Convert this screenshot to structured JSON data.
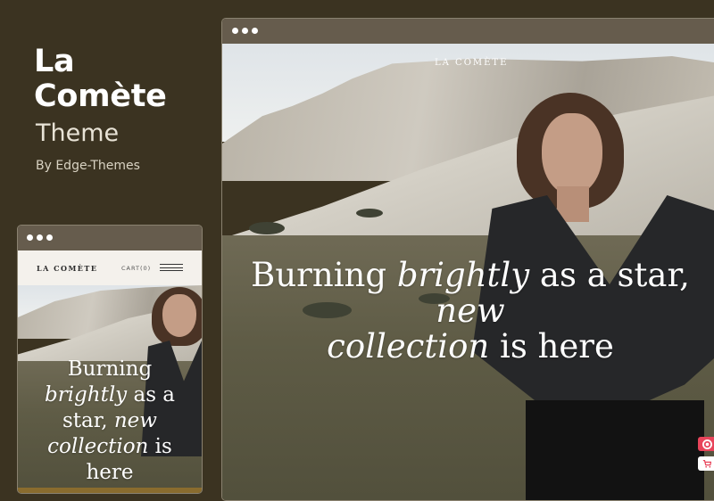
{
  "promo": {
    "title_line1": "La",
    "title_line2": "Comète",
    "subtitle": "Theme",
    "byline": "By Edge-Themes"
  },
  "desktop_preview": {
    "brand": "LA COMÈTE",
    "headline_part1": "Burning ",
    "headline_italic1": "brightly",
    "headline_part2": " as a star, ",
    "headline_italic2": "new",
    "headline_italic3": "collection",
    "headline_part3": " is here"
  },
  "mobile_preview": {
    "brand": "LA COMÈTE",
    "cart_label": "CART(0)",
    "headline_line1": "Burning",
    "headline_italic1": "brightly",
    "headline_part2": " as a",
    "headline_part3": "star, ",
    "headline_italic2": "new",
    "headline_italic3": "collection",
    "headline_part4": " is here"
  },
  "side_buttons": {
    "icons": [
      "lifebuoy-icon",
      "cart-icon"
    ]
  },
  "colors": {
    "background": "#3b3321",
    "window_bar": "#665c4d",
    "accent_red": "#e8445a"
  }
}
